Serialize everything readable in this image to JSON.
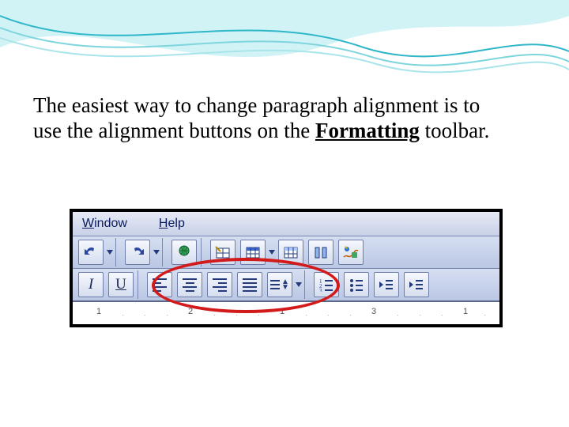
{
  "body": {
    "seg1": "The easiest way to change paragraph alignment is to use the alignment buttons on the ",
    "bold_underline": "Formatting",
    "seg2": " toolbar."
  },
  "menubar": {
    "window": {
      "u": "W",
      "rest": "indow"
    },
    "help": {
      "u": "H",
      "rest": "elp"
    }
  },
  "glyphs": {
    "italic": "I",
    "underline": "U"
  },
  "ruler": {
    "n1": "1",
    "n2": "2",
    "n3": "1",
    "n4": "3",
    "n5": "1"
  }
}
